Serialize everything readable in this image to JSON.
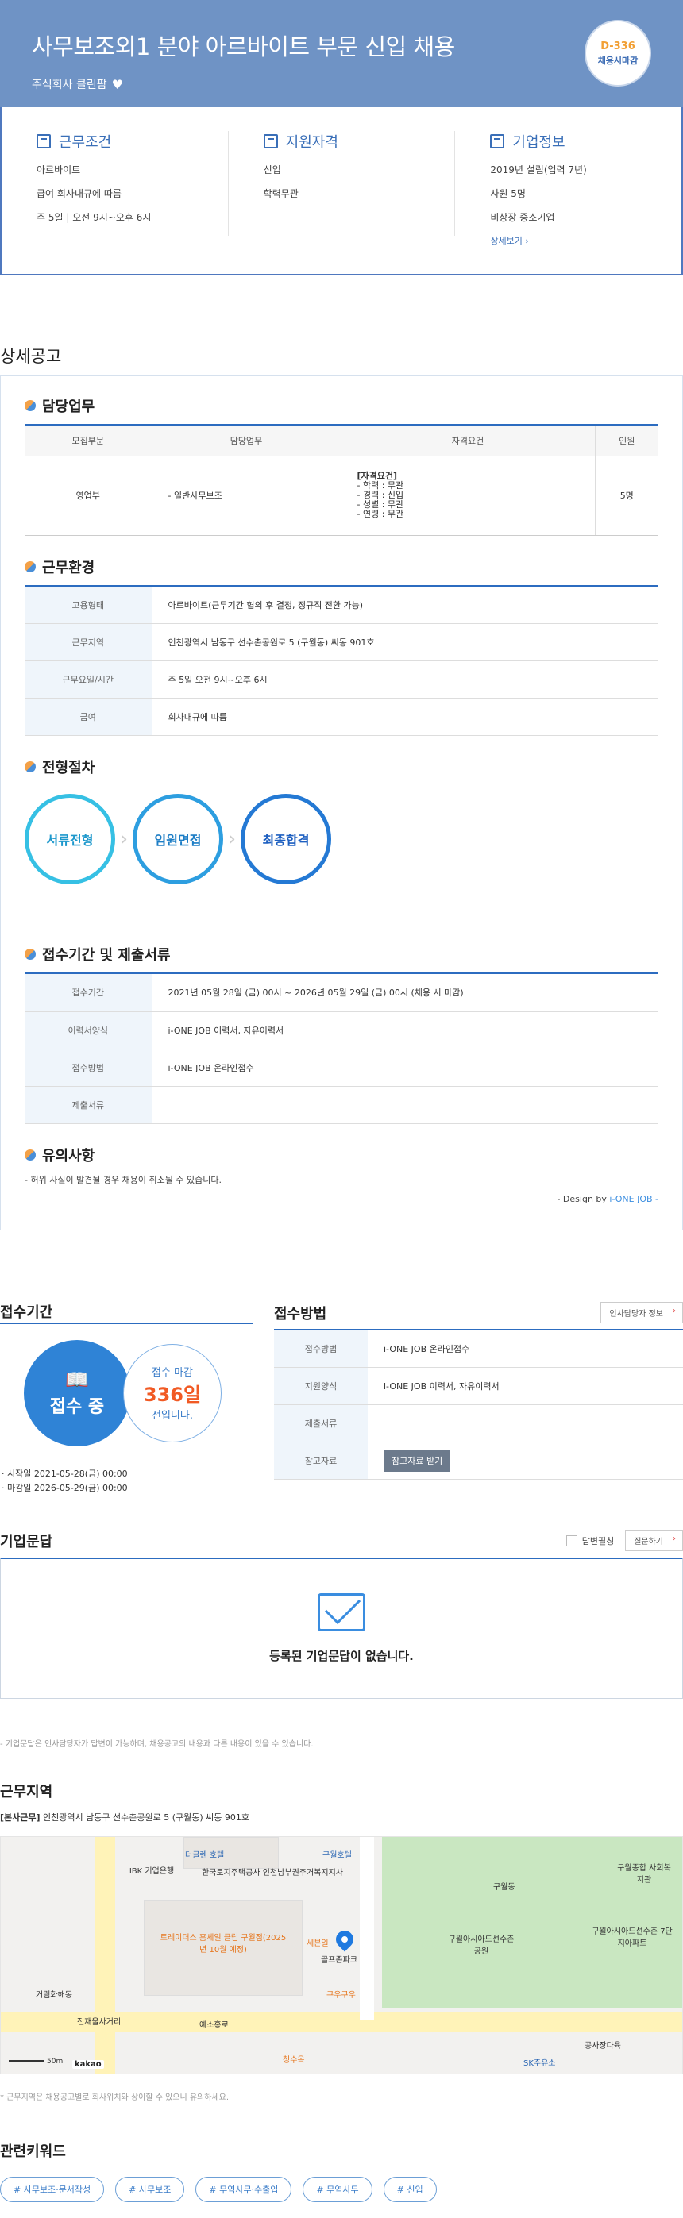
{
  "header": {
    "title": "사무보조외1 분야 아르바이트 부문 신입 채용",
    "company": "주식회사 클린팜",
    "dday": "D-336",
    "deadline_badge": "채용시마감"
  },
  "info": {
    "conditions": {
      "title": "근무조건",
      "lines": [
        "아르바이트",
        "급여 회사내규에 따름",
        "주 5일 | 오전 9시~오후 6시"
      ]
    },
    "qualifications": {
      "title": "지원자격",
      "lines": [
        "신입",
        "학력무관"
      ]
    },
    "company": {
      "title": "기업정보",
      "lines": [
        "2019년 설립(업력 7년)",
        "사원 5명",
        "비상장 중소기업"
      ],
      "link": "상세보기"
    }
  },
  "detail": {
    "title": "상세공고",
    "duty": {
      "title": "담당업무",
      "headers": [
        "모집부문",
        "담당업무",
        "자격요건",
        "인원"
      ],
      "row": {
        "dept": "영업부",
        "task": "- 일반사무보조",
        "req_title": "[자격요건]",
        "reqs": [
          "- 학력 : 무관",
          "- 경력 : 신입",
          "- 성별 : 무관",
          "- 연령 : 무관"
        ],
        "count": "5명"
      }
    },
    "env": {
      "title": "근무환경",
      "rows": [
        {
          "k": "고용형태",
          "v": "아르바이트(근무기간 협의 후 결정, 정규직 전환 가능)"
        },
        {
          "k": "근무지역",
          "v": "인천광역시 남동구 선수촌공원로 5 (구월동) 씨동 901호"
        },
        {
          "k": "근무요일/시간",
          "v": "주 5일 오전 9시~오후 6시"
        },
        {
          "k": "급여",
          "v": "회사내규에 따름"
        }
      ]
    },
    "process": {
      "title": "전형절차",
      "steps": [
        "서류전형",
        "임원면접",
        "최종합격"
      ]
    },
    "period": {
      "title": "접수기간 및 제출서류",
      "rows": [
        {
          "k": "접수기간",
          "v": "2021년 05월 28일 (금) 00시 ~ 2026년 05월 29일 (금) 00시 (채용 시 마감)"
        },
        {
          "k": "이력서양식",
          "v": "i-ONE JOB 이력서, 자유이력서"
        },
        {
          "k": "접수방법",
          "v": "i-ONE JOB 온라인접수"
        },
        {
          "k": "제출서류",
          "v": ""
        }
      ]
    },
    "caution": {
      "title": "유의사항",
      "text": "- 허위 사실이 발견될 경우 채용이 취소될 수 있습니다."
    },
    "design_prefix": "- Design by ",
    "design_brand": "i-ONE JOB -"
  },
  "apply": {
    "period_title": "접수기간",
    "status": "접수 중",
    "remain_prefix": "접수 마감",
    "remain_days": "336일",
    "remain_suffix": "전입니다.",
    "start": "· 시작일 2021-05-28(금) 00:00",
    "end": "· 마감일 2026-05-29(금) 00:00",
    "method_title": "접수방법",
    "contact_btn": "인사담당자 정보",
    "rows": [
      {
        "k": "접수방법",
        "v": "i-ONE JOB 온라인접수"
      },
      {
        "k": "지원양식",
        "v": "i-ONE JOB 이력서, 자유이력서"
      },
      {
        "k": "제출서류",
        "v": ""
      },
      {
        "k": "참고자료",
        "v": ""
      }
    ],
    "ref_btn": "참고자료 받기"
  },
  "qna": {
    "title": "기업문답",
    "answered_label": "답변필칭",
    "ask_btn": "질문하기",
    "empty": "등록된 기업문답이 없습니다.",
    "note": "- 기업문답은 인사담당자가 답변이 가능하며, 채용공고의 내용과 다른 내용이 있을 수 있습니다."
  },
  "location": {
    "title": "근무지역",
    "addr_tag": "[본사근무]",
    "addr": " 인천광역시 남동구 선수촌공원로 5 (구월동) 씨동 901호",
    "map_labels": [
      "더글렌 호텔",
      "구월호텔",
      "IBK 기업은행",
      "한국토지주택공사 인천남부권주거복지지사",
      "트레이더스 홈세일 클럽 구월점(2025년 10월 예정)",
      "골프존파크",
      "세븐일",
      "쿠우쿠우",
      "거림화해동",
      "전재울사거리",
      "예소홍로",
      "청수옥",
      "SK주유소",
      "공사장다육",
      "구월동",
      "구월아시아드선수촌공원",
      "구월종합 사회복지관",
      "구월아시아드선수촌 7단지아파트"
    ],
    "scale": "50m",
    "kakao": "kakao",
    "note": "* 근무지역은 채용공고별로 회사위치와 상이할 수 있으니 유의하세요."
  },
  "keywords": {
    "title": "관련키워드",
    "items": [
      "# 사무보조·문서작성",
      "# 사무보조",
      "# 무역사무·수출입",
      "# 무역사무",
      "# 신입"
    ]
  }
}
